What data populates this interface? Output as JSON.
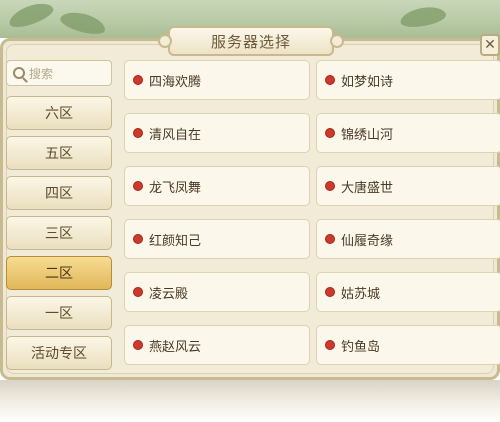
{
  "window": {
    "title": "服务器选择"
  },
  "close": {
    "label": "✕"
  },
  "search": {
    "placeholder": "搜索"
  },
  "tabs": [
    {
      "label": "六区",
      "active": false
    },
    {
      "label": "五区",
      "active": false
    },
    {
      "label": "四区",
      "active": false
    },
    {
      "label": "三区",
      "active": false
    },
    {
      "label": "二区",
      "active": true
    },
    {
      "label": "一区",
      "active": false
    },
    {
      "label": "活动专区",
      "active": false
    }
  ],
  "servers": [
    {
      "name": "四海欢腾",
      "status_color": "#cc3a2c"
    },
    {
      "name": "如梦如诗",
      "status_color": "#cc3a2c"
    },
    {
      "name": "清风自在",
      "status_color": "#cc3a2c"
    },
    {
      "name": "锦绣山河",
      "status_color": "#cc3a2c"
    },
    {
      "name": "龙飞凤舞",
      "status_color": "#cc3a2c"
    },
    {
      "name": "大唐盛世",
      "status_color": "#cc3a2c"
    },
    {
      "name": "红颜知己",
      "status_color": "#cc3a2c"
    },
    {
      "name": "仙履奇缘",
      "status_color": "#cc3a2c"
    },
    {
      "name": "凌云殿",
      "status_color": "#cc3a2c"
    },
    {
      "name": "姑苏城",
      "status_color": "#cc3a2c"
    },
    {
      "name": "燕赵风云",
      "status_color": "#cc3a2c"
    },
    {
      "name": "钓鱼岛",
      "status_color": "#cc3a2c"
    }
  ],
  "colors": {
    "frame": "#efe8d3",
    "accent_active": "#e2b75a",
    "status_dot": "#cc3a2c"
  }
}
